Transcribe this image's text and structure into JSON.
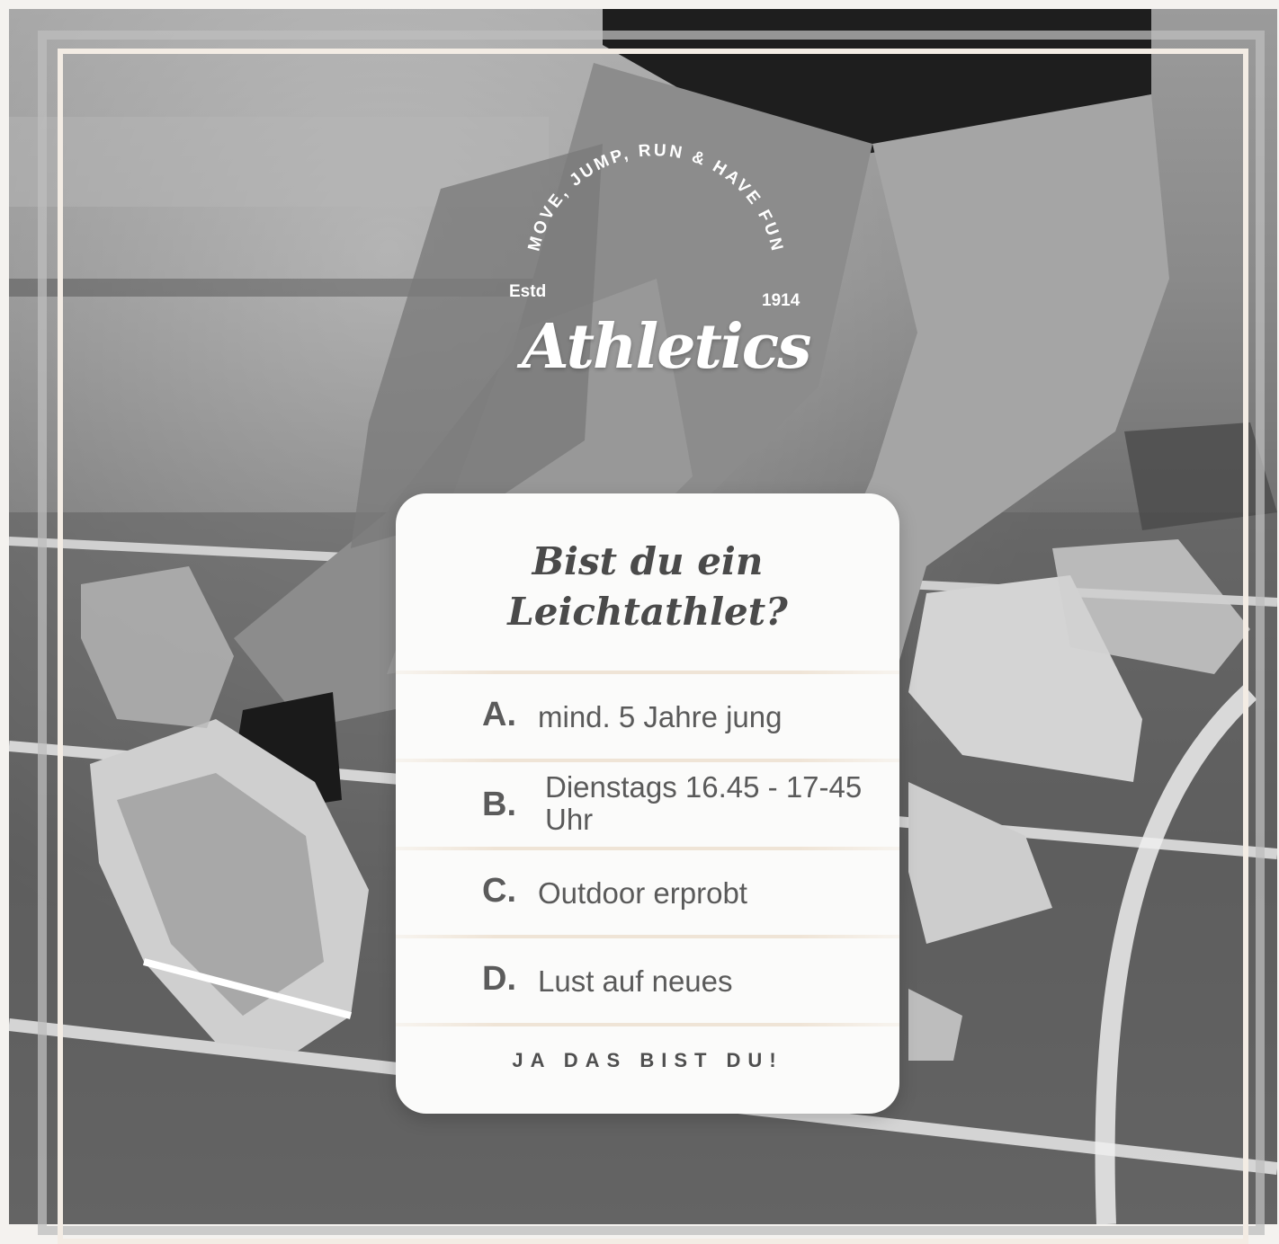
{
  "logo": {
    "arc_text": "MOVE, JUMP, RUN & HAVE FUN",
    "estd": "Estd",
    "year": "1914",
    "name": "Athletics"
  },
  "card": {
    "title_line1": "Bist du ein",
    "title_line2": "Leichtathlet?",
    "options": [
      {
        "letter": "A.",
        "text": "mind. 5 Jahre jung"
      },
      {
        "letter": "B.",
        "text": "Dienstags 16.45 - 17-45 Uhr"
      },
      {
        "letter": "C.",
        "text": "Outdoor erprobt"
      },
      {
        "letter": "D.",
        "text": "Lust auf neues"
      }
    ],
    "cta": "JA DAS BIST DU!"
  },
  "colors": {
    "frame": "#f3ece4",
    "card_bg": "#fbfbfa",
    "text": "#4a4a4a"
  }
}
